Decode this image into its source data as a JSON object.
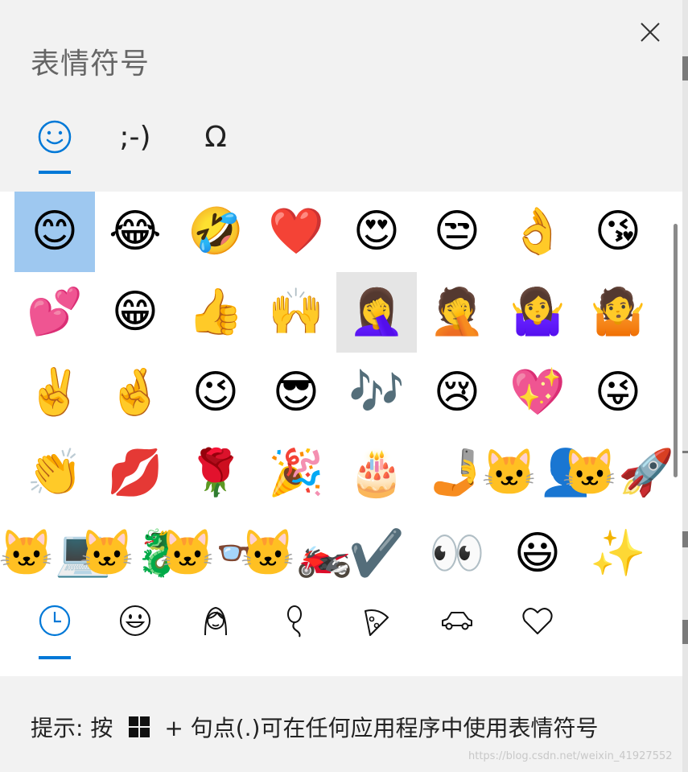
{
  "header": {
    "title": "表情符号",
    "close_icon": "close-icon"
  },
  "top_tabs": [
    {
      "name": "smiley-tab",
      "icon": "smiley-face-icon",
      "label": "",
      "active": true
    },
    {
      "name": "kaomoji-tab",
      "label": ";-)",
      "active": false
    },
    {
      "name": "symbols-tab",
      "label": "Ω",
      "active": false
    }
  ],
  "emoji_grid": {
    "rows": [
      [
        "😊",
        "😂",
        "🤣",
        "❤️",
        "😍",
        "😒",
        "👌",
        "😘"
      ],
      [
        "💕",
        "😁",
        "👍",
        "🙌",
        "🤦‍♀️",
        "🤦",
        "🤷‍♀️",
        "🤷"
      ],
      [
        "✌️",
        "🤞",
        "😉",
        "😎",
        "🎶",
        "😢",
        "💖",
        "😜"
      ],
      [
        "👏",
        "💋",
        "🌹",
        "🎉",
        "🎂",
        "🤳",
        "🐱‍👤",
        "🐱‍🚀"
      ],
      [
        "🐱‍💻",
        "🐱‍🐉",
        "🐱‍👓",
        "🐱‍🏍",
        "✔️",
        "👀",
        "😃",
        "✨"
      ]
    ],
    "selected": "😊",
    "hovered": "🤦‍♀️"
  },
  "categories": [
    {
      "name": "recent",
      "icon": "clock-icon",
      "active": true
    },
    {
      "name": "smileys",
      "icon": "smiley-outline-icon"
    },
    {
      "name": "people",
      "icon": "person-icon"
    },
    {
      "name": "celebration",
      "icon": "balloon-icon"
    },
    {
      "name": "food",
      "icon": "pizza-icon"
    },
    {
      "name": "travel",
      "icon": "car-icon"
    },
    {
      "name": "symbols",
      "icon": "heart-outline-icon"
    }
  ],
  "footer": {
    "hint_prefix": "提示: 按",
    "windows_key_icon": "windows-logo-icon",
    "hint_suffix": "+ 句点(.)可在任何应用程序中使用表情符号"
  },
  "watermark": "https://blog.csdn.net/weixin_41927552"
}
